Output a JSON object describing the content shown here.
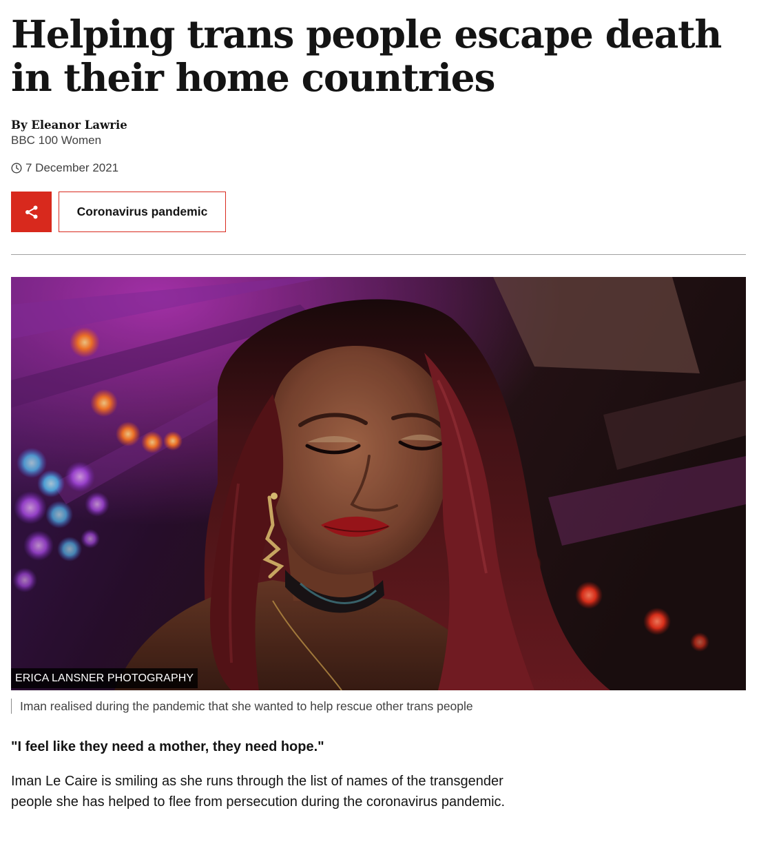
{
  "article": {
    "headline": "Helping trans people escape death in their home countries",
    "author": "By Eleanor Lawrie",
    "author_role": "BBC 100 Women",
    "date": "7 December 2021",
    "topic_tag": "Coronavirus pandemic",
    "share_icon": "share-icon",
    "clock_icon": "clock-icon",
    "accent_color": "#d8291d"
  },
  "hero_image": {
    "credit": "ERICA LANSNER PHOTOGRAPHY",
    "caption": "Iman realised during the pandemic that she wanted to help rescue other trans people"
  },
  "body": {
    "quote": "\"I feel like they need a mother, they need hope.\"",
    "paragraph_1": "Iman Le Caire is smiling as she runs through the list of names of the transgender people she has helped to flee from persecution during the coronavirus pandemic."
  }
}
